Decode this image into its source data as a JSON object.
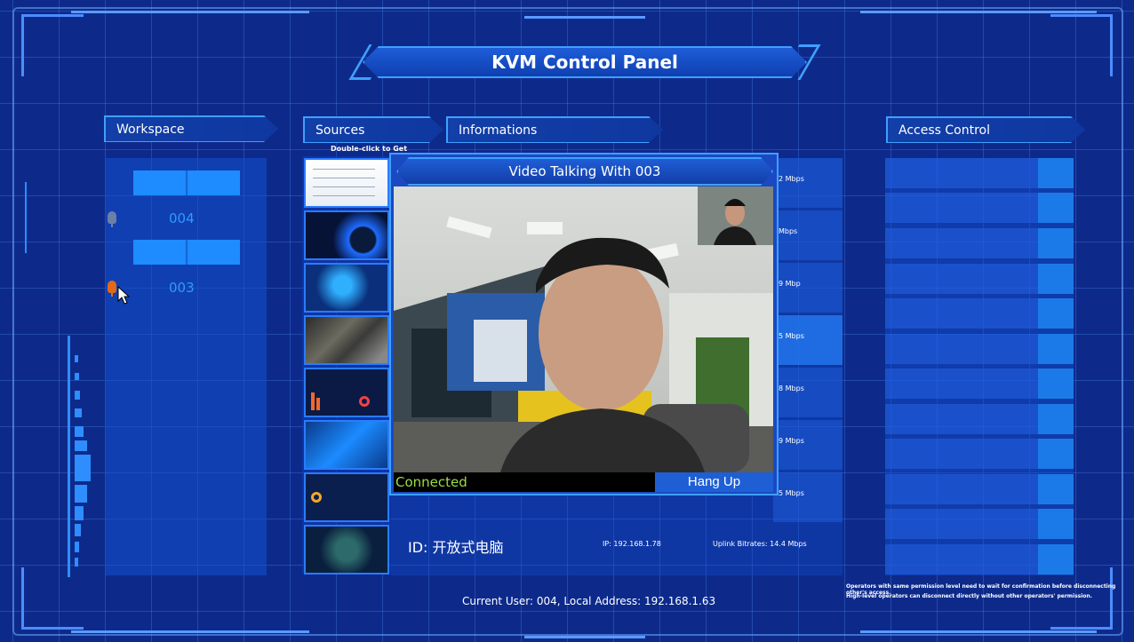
{
  "title": "KVM Control Panel",
  "sections": {
    "workspace": "Workspace",
    "sources": "Sources",
    "informations": "Informations",
    "access_control": "Access Control"
  },
  "sources_hint": "Double-click to Get",
  "workspace": {
    "items": [
      {
        "label": "004",
        "mic_color": "#6b7fa8"
      },
      {
        "label": "003",
        "mic_color": "#e06a1a"
      }
    ]
  },
  "video": {
    "title": "Video Talking With 003",
    "status": "Connected",
    "hangup_label": "Hang Up"
  },
  "info": {
    "rates": [
      "2 Mbps",
      "Mbps",
      "9 Mbp",
      "5 Mbps",
      "8 Mbps",
      "9 Mbps",
      "5 Mbps"
    ],
    "last_row": {
      "id": "ID: 开放式电脑",
      "ip": "IP: 192.168.1.78",
      "uplink": "Uplink Bitrates: 14.4 Mbps"
    }
  },
  "access_note": [
    "Operators with same permission level need to wait for confirmation before disconnecting other's access.",
    "High-level operators can disconnect directly without other operators' permission."
  ],
  "footer": "Current User: 004, Local Address: 192.168.1.63",
  "colors": {
    "background": "#0d2a8a",
    "accent": "#1e8bff",
    "connected_text": "#9bdc42"
  }
}
